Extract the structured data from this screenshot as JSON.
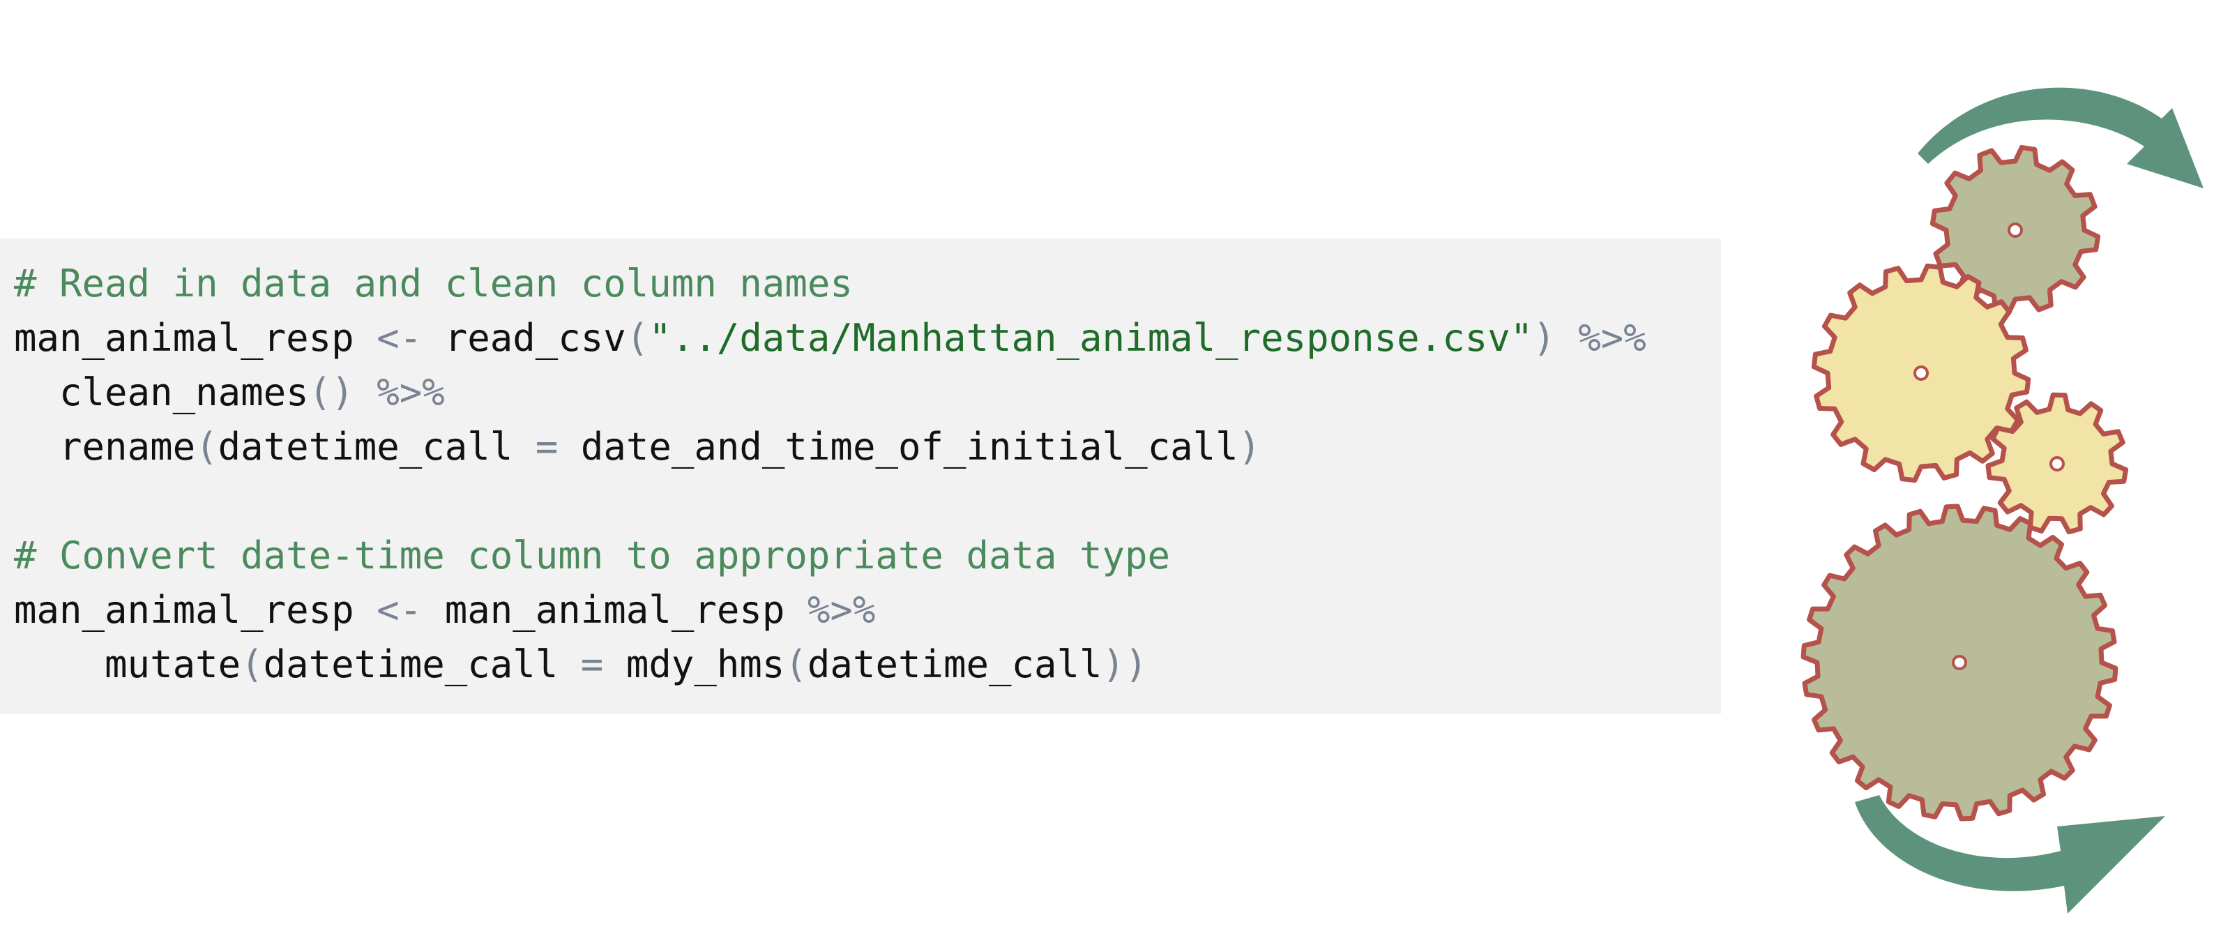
{
  "code": {
    "comment_1": "# Read in data and clean column names",
    "l2_var": "man_animal_resp",
    "l2_assign": " <- ",
    "l2_func": "read_csv",
    "l2_open": "(",
    "l2_str": "\"../data/Manhattan_animal_response.csv\"",
    "l2_close": ")",
    "l2_pipe": " %>%",
    "l3_indent": "  ",
    "l3_func": "clean_names",
    "l3_parens": "()",
    "l3_pipe": " %>%",
    "l4_indent": "  ",
    "l4_func": "rename",
    "l4_open": "(",
    "l4_arg": "datetime_call",
    "l4_eq": " = ",
    "l4_val": "date_and_time_of_initial_call",
    "l4_close": ")",
    "comment_2": "# Convert date-time column to appropriate data type",
    "l7_var": "man_animal_resp",
    "l7_assign": " <- ",
    "l7_val": "man_animal_resp",
    "l7_pipe": " %>%",
    "l8_indent": "    ",
    "l8_func": "mutate",
    "l8_open": "(",
    "l8_arg": "datetime_call",
    "l8_eq": " = ",
    "l8_inner": "mdy_hms",
    "l8_open2": "(",
    "l8_inner_arg": "datetime_call",
    "l8_close": "))"
  },
  "colors": {
    "background": "#ffffff",
    "code_background": "#f2f2f2",
    "comment": "#4a8a5d",
    "operator": "#7a8394",
    "string": "#1f6b2a",
    "gear_green": "#b9bc98",
    "gear_yellow": "#f2e3a6",
    "gear_outline": "#b5524b",
    "arrow": "#4f8a72"
  },
  "illustration": {
    "icon": "rotating-gears-icon"
  }
}
